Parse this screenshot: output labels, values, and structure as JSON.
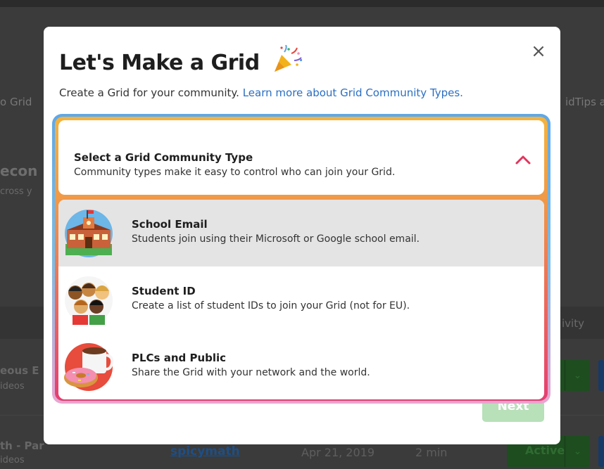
{
  "background": {
    "left_text": "o Grid",
    "right_text": "idTips a",
    "section_heading": "econ",
    "section_sub": "cross y",
    "band_text": "ivity",
    "rows": [
      {
        "title": "eous E",
        "sub": "ideos"
      },
      {
        "title": "th - Par",
        "sub": "ideos",
        "author": "spicymath",
        "date": "Apr 21, 2019",
        "duration": "2 min",
        "status": "Active"
      }
    ]
  },
  "modal": {
    "title": "Let's Make a Grid",
    "title_icon": "party-popper-icon",
    "close_label": "×",
    "subtitle": "Create a Grid for your community.",
    "learn_more_link": "Learn more about Grid Community Types.",
    "next_label": "Next",
    "dropdown": {
      "title": "Select a Grid Community Type",
      "description": "Community types make it easy to control who can join your Grid.",
      "toggle_icon": "chevron-up-icon",
      "options": [
        {
          "title": "School Email",
          "description": "Students join using their Microsoft or Google school email.",
          "icon": "school-building-icon",
          "selected": true
        },
        {
          "title": "Student ID",
          "description": "Create a list of student IDs to join your Grid (not for EU).",
          "icon": "students-group-icon",
          "selected": false
        },
        {
          "title": "PLCs and Public",
          "description": "Share the Grid with your network and the world.",
          "icon": "coffee-donut-icon",
          "selected": false
        }
      ]
    }
  },
  "colors": {
    "accent_link": "#2a6fc2",
    "next_button_disabled": "#b8e0b9",
    "chevron": "#e0365c",
    "panel_gradient_top": "#f3b33e",
    "panel_gradient_bottom": "#e43e72"
  }
}
